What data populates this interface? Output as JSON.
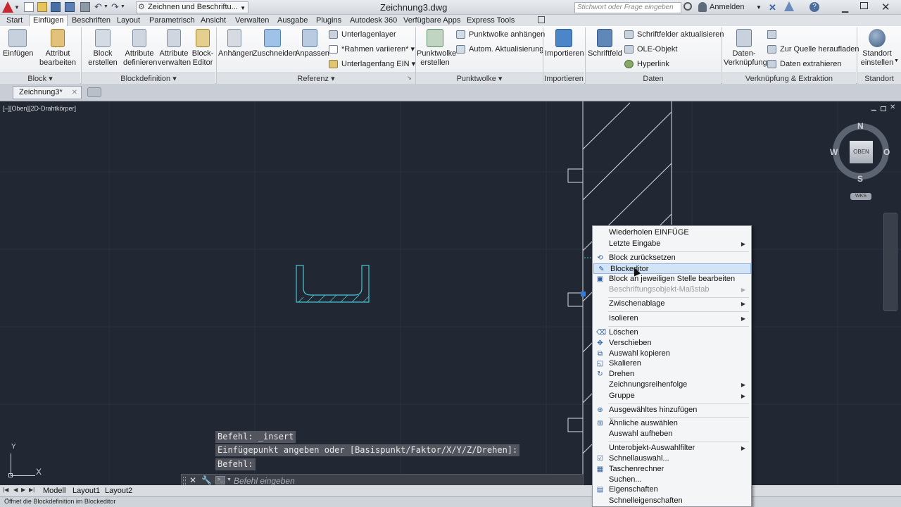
{
  "title_bar": {
    "workspace": "Zeichnen und Beschriftu...",
    "document_title": "Zeichnung3.dwg",
    "search_placeholder": "Stichwort oder Frage eingeben",
    "sign_in": "Anmelden"
  },
  "ribbon_tabs": [
    "Start",
    "Einfügen",
    "Beschriften",
    "Layout",
    "Parametrisch",
    "Ansicht",
    "Verwalten",
    "Ausgabe",
    "Plugins",
    "Autodesk 360",
    "Verfügbare Apps",
    "Express Tools"
  ],
  "ribbon": {
    "block": {
      "insert": "Einfügen",
      "edit_attr_1": "Attribut",
      "edit_attr_2": "bearbeiten",
      "panel": "Block"
    },
    "blockdef": {
      "create_1": "Block",
      "create_2": "erstellen",
      "define_1": "Attribute",
      "define_2": "definieren",
      "manage_1": "Attribute",
      "manage_2": "verwalten",
      "editor_1": "Block-",
      "editor_2": "Editor",
      "panel": "Blockdefinition"
    },
    "reference": {
      "attach": "Anhängen",
      "clip": "Zuschneiden",
      "adjust": "Anpassen",
      "underlay_layers": "Unterlagenlayer",
      "frames": "*Rahmen variieren*",
      "snap": "Unterlagenfang EIN",
      "panel": "Referenz"
    },
    "pointcloud": {
      "create_1": "Punktwolke",
      "create_2": "erstellen",
      "attach": "Punktwolke anhängen",
      "auto_update": "Autom. Aktualisierung",
      "panel": "Punktwolke"
    },
    "import": {
      "import": "Importieren",
      "panel": "Importieren"
    },
    "data": {
      "field": "Schriftfeld",
      "update_fields": "Schriftfelder aktualisieren",
      "ole": "OLE-Objekt",
      "hyperlink": "Hyperlink",
      "panel": "Daten"
    },
    "linking": {
      "data_link_1": "Daten-",
      "data_link_2": "Verknüpfung",
      "upload": "Zur Quelle heraufladen",
      "extract": "Daten  extrahieren",
      "panel": "Verknüpfung & Extraktion"
    },
    "location": {
      "set_1": "Standort",
      "set_2": "einstellen",
      "panel": "Standort"
    }
  },
  "doc_tab": "Zeichnung3*",
  "viewport_label": "[–][Oben][2D-Drahtkörper]",
  "viewcube": {
    "north": "N",
    "south": "S",
    "west": "W",
    "east": "O",
    "top": "OBEN",
    "ucs": "WKS"
  },
  "command_history": [
    "Befehl: _insert",
    "Einfügepunkt angeben oder [Basispunkt/Faktor/X/Y/Z/Drehen]:",
    "Befehl:"
  ],
  "command_placeholder": "Befehl eingeben",
  "context_menu": {
    "repeat": "Wiederholen EINFÜGE",
    "recent": "Letzte Eingabe",
    "reset_block": "Block zurücksetzen",
    "block_editor": "Blockeditor",
    "refedit": "Block an jeweiligen Stelle bearbeiten",
    "annoscale": "Beschriftungsobjekt-Maßstab",
    "clipboard": "Zwischenablage",
    "isolate": "Isolieren",
    "erase": "Löschen",
    "move": "Verschieben",
    "copy": "Auswahl kopieren",
    "scale": "Skalieren",
    "rotate": "Drehen",
    "draworder": "Zeichnungsreihenfolge",
    "group": "Gruppe",
    "add_selected": "Ausgewähltes hinzufügen",
    "select_similar": "Ähnliche auswählen",
    "deselect": "Auswahl aufheben",
    "subobject": "Unterobjekt-Auswahlfilter",
    "quickselect": "Schnellauswahl...",
    "calculator": "Taschenrechner",
    "find": "Suchen...",
    "properties": "Eigenschaften",
    "quickprops": "Schnelleigenschaften"
  },
  "layout_tabs": [
    "Modell",
    "Layout1",
    "Layout2"
  ],
  "status_text": "Öffnet die Blockdefinition im Blockeditor",
  "ucs_icon": {
    "y": "Y",
    "x": "X"
  }
}
